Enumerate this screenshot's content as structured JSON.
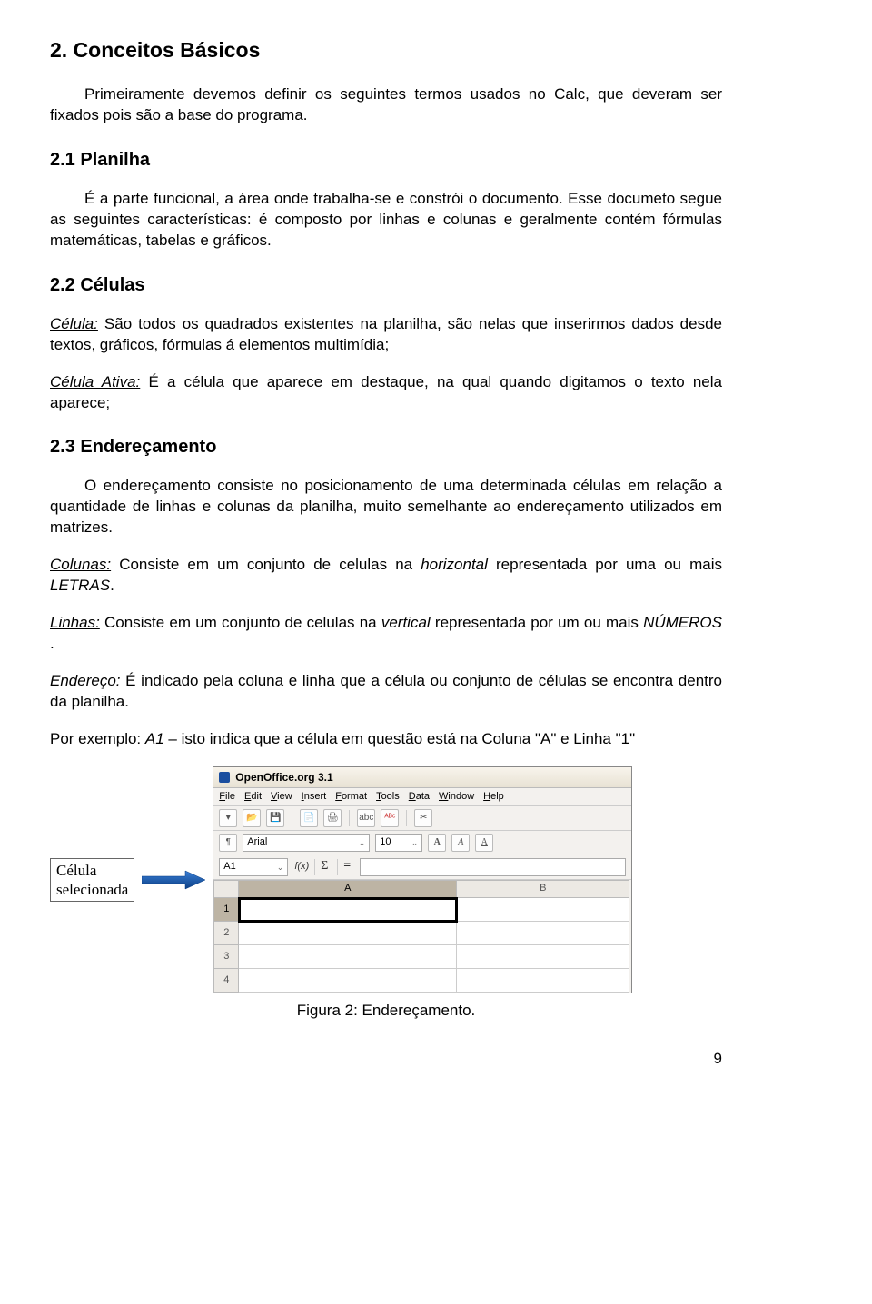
{
  "heading_main": "2. Conceitos Básicos",
  "intro": "Primeiramente devemos definir os seguintes termos usados no Calc, que deveram ser fixados pois são a base do programa.",
  "h21": "2.1 Planilha",
  "p21": "É a parte funcional, a área onde trabalha-se e constrói o documento. Esse documeto segue as seguintes características: é composto por linhas e colunas e geralmente contém fórmulas matemáticas, tabelas e gráficos.",
  "h22": "2.2 Células",
  "celula_label": "Célula:",
  "celula_txt": " São todos os quadrados existentes na planilha, são nelas que inserirmos dados desde textos, gráficos, fórmulas á elementos multimídia;",
  "celula_ativa_label": "Célula Ativa:",
  "celula_ativa_txt": " É a célula que aparece em destaque, na qual quando digitamos o texto nela aparece;",
  "h23": "2.3 Endereçamento",
  "p23a": "O endereçamento consiste no posicionamento de uma determinada células em relação a quantidade de linhas e colunas da planilha, muito semelhante ao endereçamento utilizados em matrizes.",
  "colunas_label": "Colunas:",
  "colunas_txt_a": " Consiste em um conjunto de celulas na ",
  "colunas_txt_b": "horizontal",
  "colunas_txt_c": " representada por uma ou mais ",
  "colunas_txt_d": "LETRAS",
  "colunas_txt_e": ".",
  "linhas_label": "Linhas:",
  "linhas_txt_a": " Consiste em um conjunto de celulas na ",
  "linhas_txt_b": "vertical",
  "linhas_txt_c": " representada por um ou mais ",
  "linhas_txt_d": "NÚMEROS",
  "linhas_txt_e": " .",
  "endereco_label": "Endereço:",
  "endereco_txt": " É indicado pela coluna e linha que a célula ou conjunto de células se encontra dentro da planilha.",
  "exemplo_a": "Por exemplo: ",
  "exemplo_b": "A1",
  "exemplo_c": " – isto indica que a célula em questão está na Coluna \"A\" e Linha \"1\"",
  "callout_l1": "Célula",
  "callout_l2": "selecionada",
  "app_title": "OpenOffice.org 3.1",
  "menu": [
    "File",
    "Edit",
    "View",
    "Insert",
    "Format",
    "Tools",
    "Data",
    "Window",
    "Help"
  ],
  "font_name": "Arial",
  "font_size": "10",
  "namebox": "A1",
  "cols": [
    "A",
    "B"
  ],
  "rows": [
    "1",
    "2",
    "3",
    "4"
  ],
  "caption": "Figura 2: Endereçamento.",
  "page_num": "9"
}
